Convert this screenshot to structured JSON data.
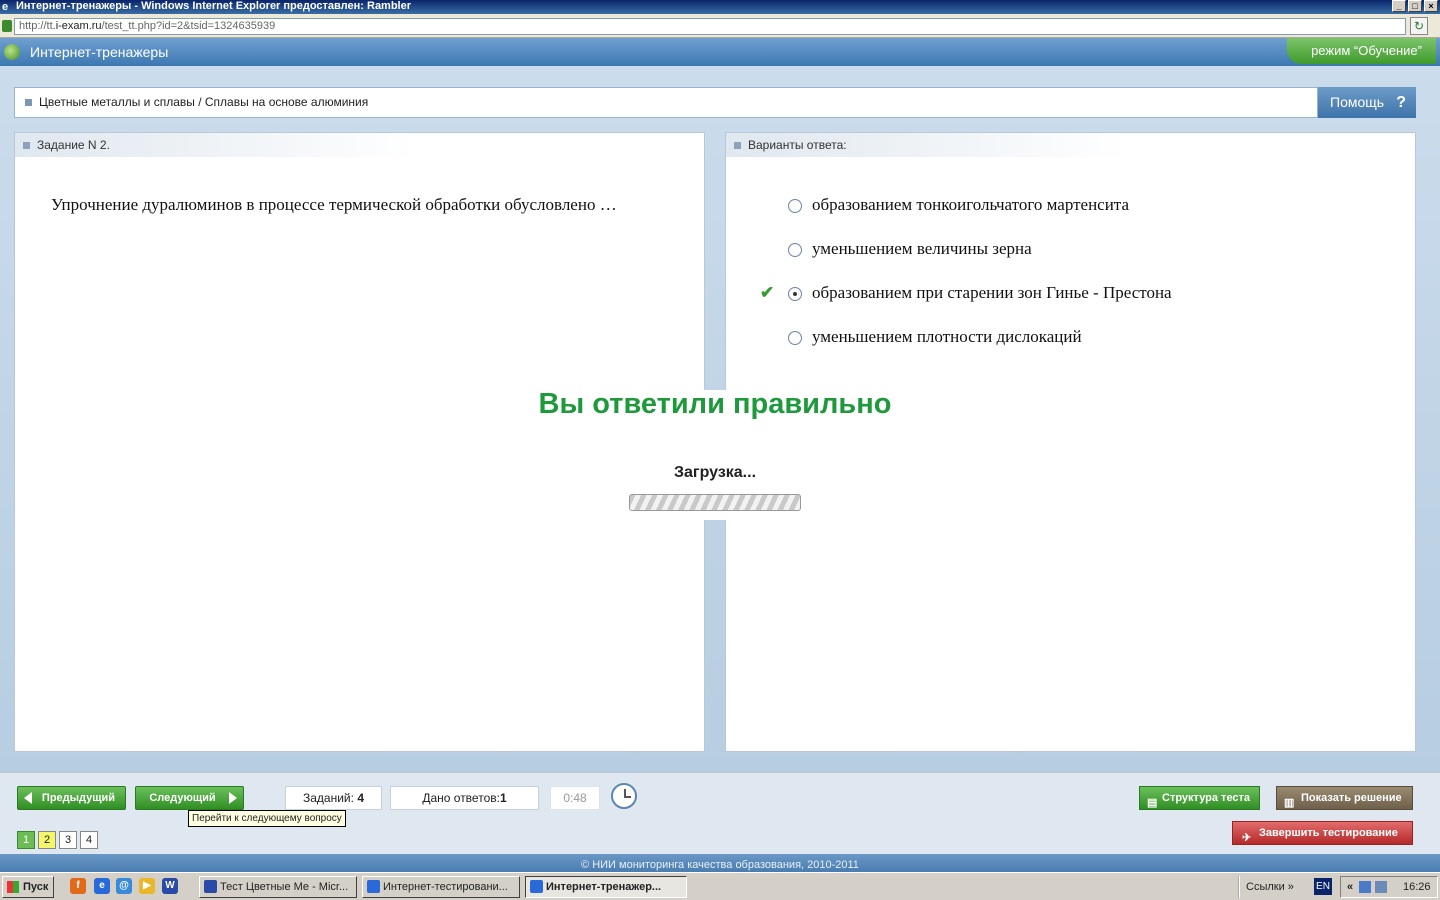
{
  "browser": {
    "window_title": "Интернет-тренажеры - Windows Internet Explorer предоставлен: Rambler",
    "url_prefix": "http://tt.",
    "url_domain": "i-exam.ru",
    "url_path": "/test_tt.php?id=2&tsid=1324635939"
  },
  "app": {
    "title": "Интернет-тренажеры",
    "mode": "режим “Обучение”",
    "breadcrumb": "Цветные металлы и сплавы / Сплавы на основе алюминия",
    "help_label": "Помощь"
  },
  "task": {
    "header": "Задание N 2.",
    "question": "Упрочнение дуралюминов в процессе термической обработки обусловлено …"
  },
  "answers": {
    "header": "Варианты ответа:",
    "options": [
      {
        "label": "образованием тонкоигольчатого мартенсита",
        "selected": false,
        "correct": false
      },
      {
        "label": "уменьшением величины зерна",
        "selected": false,
        "correct": false
      },
      {
        "label": "образованием при старении зон Гинье - Престона",
        "selected": true,
        "correct": true
      },
      {
        "label": "уменьшением плотности дислокаций",
        "selected": false,
        "correct": false
      }
    ]
  },
  "feedback": {
    "result": "Вы ответили правильно",
    "loading": "Загрузка...",
    "result_color": "#1e9a3c"
  },
  "controls": {
    "prev_label": "Предыдущий",
    "next_label": "Следующий",
    "next_tooltip": "Перейти к следующему вопросу",
    "tasks_label": "Заданий:",
    "tasks_count": "4",
    "answered_label": "Дано ответов:",
    "answered_count": "1",
    "timer": "0:48",
    "structure_label": "Структура теста",
    "solution_label": "Показать решение",
    "finish_label": "Завершить тестирование",
    "question_numbers": [
      "1",
      "2",
      "3",
      "4"
    ]
  },
  "footer": {
    "copyright": "© НИИ мониторинга качества образования, 2010-2011"
  },
  "taskbar": {
    "start_label": "Пуск",
    "tasks": [
      "Тест Цветные Ме - Micr...",
      "Интернет-тестировани...",
      "Интернет-тренажер..."
    ],
    "links_label": "Ссылки",
    "lang": "EN",
    "time": "16:26"
  }
}
